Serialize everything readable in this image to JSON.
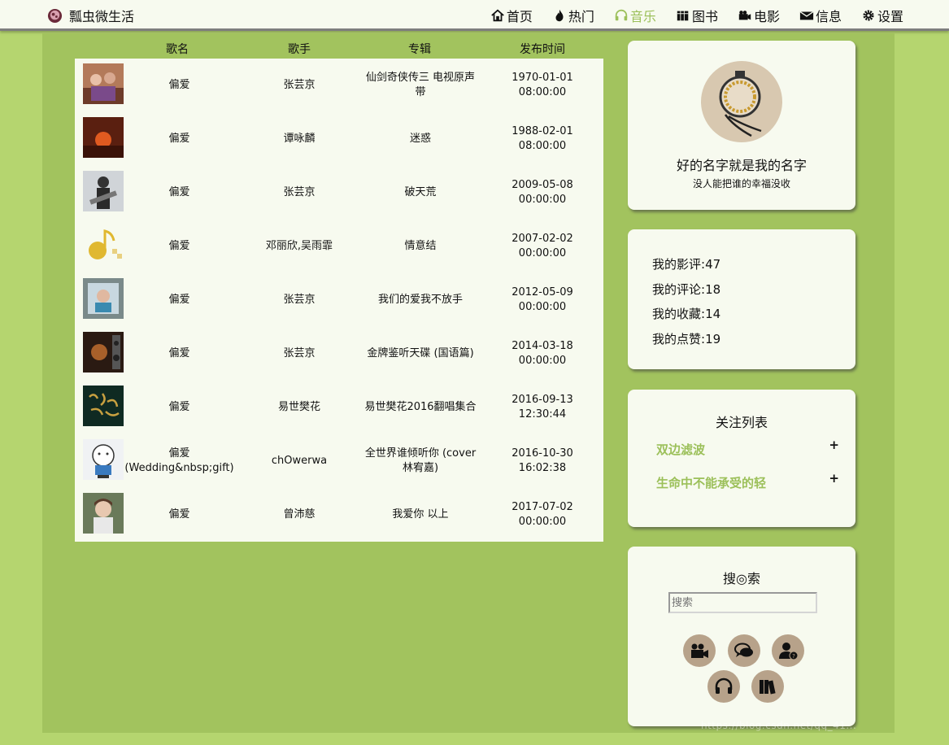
{
  "header": {
    "brand": "瓢虫微生活",
    "nav": [
      {
        "label": "首页",
        "icon": "home-icon"
      },
      {
        "label": "热门",
        "icon": "fire-icon"
      },
      {
        "label": "音乐",
        "icon": "headphones-icon",
        "active": true
      },
      {
        "label": "图书",
        "icon": "books-icon"
      },
      {
        "label": "电影",
        "icon": "video-camera-icon"
      },
      {
        "label": "信息",
        "icon": "envelope-icon"
      },
      {
        "label": "设置",
        "icon": "gear-icon"
      }
    ]
  },
  "table": {
    "headers": {
      "song": "歌名",
      "artist": "歌手",
      "album": "专辑",
      "date": "发布时间"
    },
    "rows": [
      {
        "song": "偏爱",
        "artist": "张芸京",
        "album": "仙剑奇侠传三 电视原声带",
        "date": "1970-01-01 08:00:00"
      },
      {
        "song": "偏爱",
        "artist": "谭咏麟",
        "album": "迷惑",
        "date": "1988-02-01 08:00:00"
      },
      {
        "song": "偏爱",
        "artist": "张芸京",
        "album": "破天荒",
        "date": "2009-05-08 00:00:00"
      },
      {
        "song": "偏爱",
        "artist": "邓丽欣,吴雨霏",
        "album": "情意结",
        "date": "2007-02-02 00:00:00"
      },
      {
        "song": "偏爱",
        "artist": "张芸京",
        "album": "我们的爱我不放手",
        "date": "2012-05-09 00:00:00"
      },
      {
        "song": "偏爱",
        "artist": "张芸京",
        "album": "金牌鉴听天碟 (国语篇)",
        "date": "2014-03-18 00:00:00"
      },
      {
        "song": "偏爱",
        "artist": "易世樊花",
        "album": "易世樊花2016翻唱集合",
        "date": "2016-09-13 12:30:44"
      },
      {
        "song": "偏爱 (Wedding&nbsp;gift)",
        "artist": "chOwerwa",
        "album": "全世界谁倾听你 (cover 林宥嘉)",
        "date": "2016-10-30 16:02:38"
      },
      {
        "song": "偏爱",
        "artist": "曾沛慈",
        "album": "我爱你 以上",
        "date": "2017-07-02 00:00:00"
      }
    ]
  },
  "profile": {
    "name": "好的名字就是我的名字",
    "motto": "没人能把谁的幸福没收"
  },
  "stats": [
    {
      "label": "我的影评:",
      "value": "47"
    },
    {
      "label": "我的评论:",
      "value": "18"
    },
    {
      "label": "我的收藏:",
      "value": "14"
    },
    {
      "label": "我的点赞:",
      "value": "19"
    }
  ],
  "follow": {
    "title": "关注列表",
    "items": [
      {
        "name": "双边滤波",
        "action": "+"
      },
      {
        "name": "生命中不能承受的轻",
        "action": "+"
      }
    ]
  },
  "search": {
    "title": "搜◎索",
    "placeholder": "搜索",
    "buttons": [
      "video-camera-icon",
      "comments-icon",
      "user-question-icon",
      "headphones-icon",
      "books-icon"
    ]
  },
  "watermark": "https://blog.csdn.net/qq_41..."
}
